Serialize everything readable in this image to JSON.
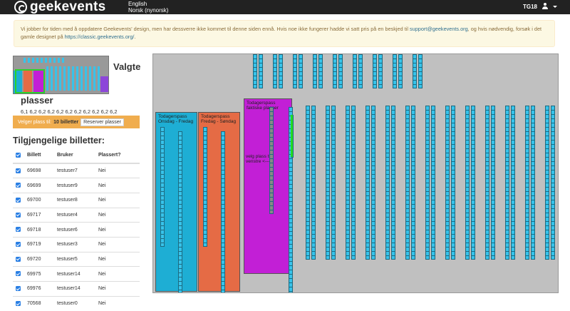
{
  "header": {
    "logo_text": "geekevents",
    "languages": [
      "English",
      "Norsk (nynorsk)"
    ],
    "user": "TG18"
  },
  "alert": {
    "text_before": "Vi jobber for tiden med å oppdatere Geekevents' design, men har dessverre ikke kommet til denne siden ennå. Hvis noe ikke fungerer hadde vi satt pris på en beskjed til ",
    "email": "support@geekevents.org",
    "text_middle": ", og hvis nødvendig, forsøk i det gamle designet på ",
    "link": "https://classic.geekevents.org/",
    "text_after": "."
  },
  "selection": {
    "title_line1": "Valgte",
    "title_line2": "plasser",
    "seats": "6,1 6,2 6,2 6,2 6,2 6,2 6,2 6,2 6,2 6,2 6,2",
    "picker_label": "Velger plass til:",
    "picker_value": "10 billetter",
    "reserve_button": "Reserver plasser"
  },
  "tickets": {
    "title": "Tilgjengelige billetter:",
    "columns": [
      "Billett",
      "Bruker",
      "Plassert?"
    ],
    "rows": [
      {
        "id": "69698",
        "user": "testuser7",
        "placed": "Nei"
      },
      {
        "id": "69699",
        "user": "testuser9",
        "placed": "Nei"
      },
      {
        "id": "69700",
        "user": "testuser8",
        "placed": "Nei"
      },
      {
        "id": "69717",
        "user": "testuser4",
        "placed": "Nei"
      },
      {
        "id": "69718",
        "user": "testuser6",
        "placed": "Nei"
      },
      {
        "id": "69719",
        "user": "testuser3",
        "placed": "Nei"
      },
      {
        "id": "69720",
        "user": "testuser5",
        "placed": "Nei"
      },
      {
        "id": "69975",
        "user": "testuser14",
        "placed": "Nei"
      },
      {
        "id": "69976",
        "user": "testuser14",
        "placed": "Nei"
      },
      {
        "id": "70568",
        "user": "testuser0",
        "placed": "Nei"
      }
    ]
  },
  "map": {
    "zones": [
      {
        "label": "Todagerspass Onsdag - Fredag",
        "color": "#1eaed4"
      },
      {
        "label": "Todagerspass Fredag - Søndag",
        "color": "#e56b45"
      },
      {
        "label": "Todagerspass faktiske plasser",
        "color": "#c21fd6"
      }
    ],
    "note": "velg plass til venstre <---",
    "colors": {
      "seat": "#37c3ea",
      "seat_taken": "#888888",
      "seat_selected": "#22dd22",
      "background": "#c0c0c0"
    }
  }
}
